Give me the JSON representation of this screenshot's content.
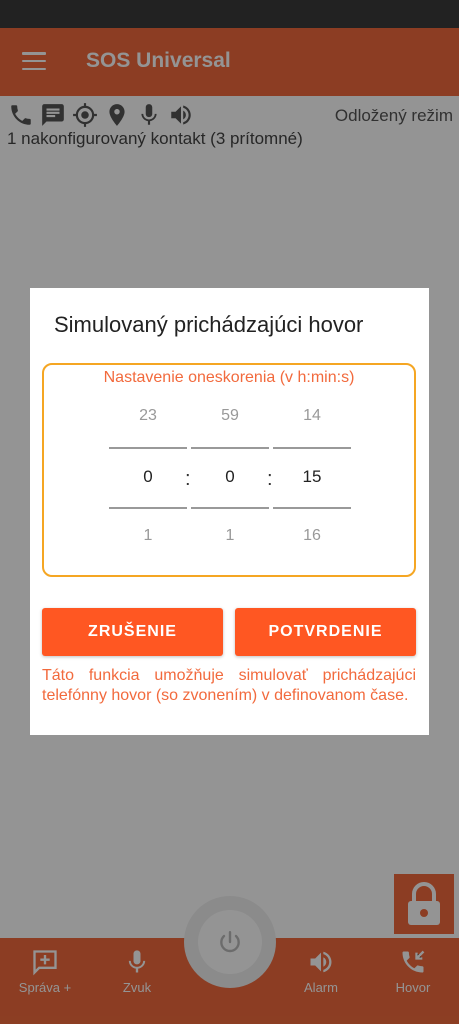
{
  "app": {
    "title": "SOS Universal",
    "mode": "Odložený režim",
    "contacts": "1 nakonfigurovaný kontakt (3 prítomné)"
  },
  "status_icons": [
    "phone-icon",
    "message-icon",
    "gps-icon",
    "location-pin-icon",
    "microphone-icon",
    "speaker-icon"
  ],
  "dialog": {
    "title": "Simulovaný prichádzajúci hovor",
    "delay_label": "Nastavenie oneskorenia (v h:min:s)",
    "hours": {
      "prev": "23",
      "current": "0",
      "next": "1"
    },
    "minutes": {
      "prev": "59",
      "current": "0",
      "next": "1"
    },
    "seconds": {
      "prev": "14",
      "current": "15",
      "next": "16"
    },
    "separator": ":",
    "cancel_label": "ZRUŠENIE",
    "confirm_label": "POTVRDENIE",
    "info": "Táto funkcia umožňuje simulovať prichádzajúci telefónny hovor (so zvonením) v definovanom čase."
  },
  "nav": {
    "message": "Správa +",
    "sound": "Zvuk",
    "alarm": "Alarm",
    "call": "Hovor"
  },
  "colors": {
    "primary": "#f26a3d",
    "button": "#ff5722",
    "picker_border": "#f5a623"
  }
}
